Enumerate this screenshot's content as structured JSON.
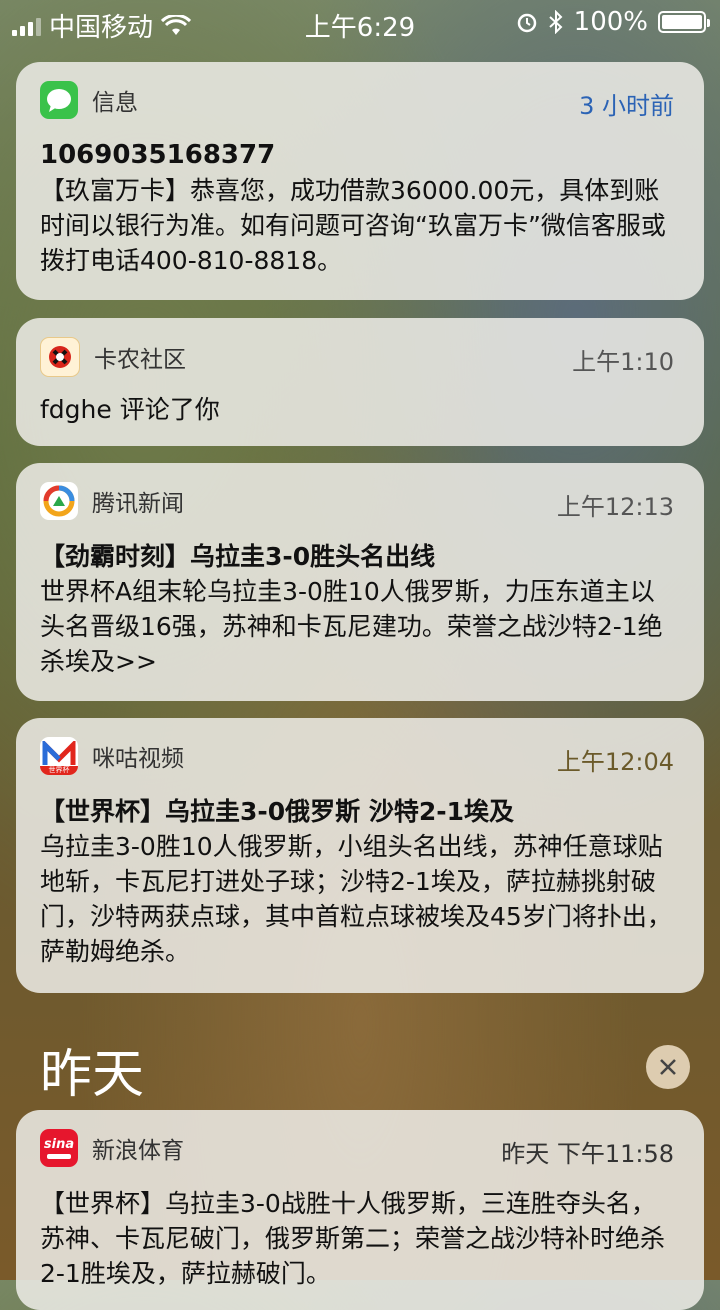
{
  "status_bar": {
    "carrier": "中国移动",
    "time": "上午6:29",
    "battery": "100%"
  },
  "notifications": [
    {
      "app": "信息",
      "time": "3 小时前",
      "title": "1069035168377",
      "body": "【玖富万卡】恭喜您，成功借款36000.00元，具体到账时间以银行为准。如有问题可咨询“玖富万卡”微信客服或拨打电话400-810-8818。"
    },
    {
      "app": "卡农社区",
      "time": "上午1:10",
      "body": "fdghe 评论了你"
    },
    {
      "app": "腾讯新闻",
      "time": "上午12:13",
      "title": "【劲霸时刻】乌拉圭3-0胜头名出线",
      "body": "世界杯A组末轮乌拉圭3-0胜10人俄罗斯，力压东道主以头名晋级16强，苏神和卡瓦尼建功。荣誉之战沙特2-1绝杀埃及>>"
    },
    {
      "app": "咪咕视频",
      "time": "上午12:04",
      "icon_text": "世界杯",
      "title": "【世界杯】乌拉圭3-0俄罗斯 沙特2-1埃及",
      "body": "乌拉圭3-0胜10人俄罗斯，小组头名出线，苏神任意球贴地斩，卡瓦尼打进处子球；沙特2-1埃及，萨拉赫挑射破门，沙特两获点球，其中首粒点球被埃及45岁门将扑出，萨勒姆绝杀。"
    }
  ],
  "section": {
    "label": "昨天",
    "clear_icon": "close-icon"
  },
  "yesterday_notifications": [
    {
      "app": "新浪体育",
      "time": "昨天 下午11:58",
      "icon_text": "sina",
      "body": "【世界杯】乌拉圭3-0战胜十人俄罗斯，三连胜夺头名，苏神、卡瓦尼破门，俄罗斯第二；荣誉之战沙特补时绝杀2-1胜埃及，萨拉赫破门。"
    }
  ],
  "colors": {
    "messages_green": "#3ac24a",
    "time_blue": "#2b63b5",
    "migu_red": "#e1261c",
    "sina_red": "#e6162d"
  }
}
